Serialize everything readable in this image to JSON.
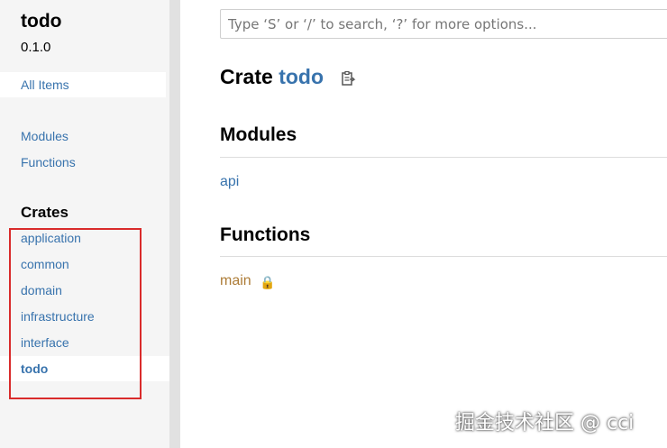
{
  "sidebar": {
    "crate_name": "todo",
    "version": "0.1.0",
    "all_items": "All Items",
    "links": [
      "Modules",
      "Functions"
    ],
    "crates_heading": "Crates",
    "crates": [
      "application",
      "common",
      "domain",
      "infrastructure",
      "interface",
      "todo"
    ],
    "current_crate": "todo"
  },
  "search": {
    "placeholder": "Type ‘S’ or ‘/’ to search, ‘?’ for more options..."
  },
  "main": {
    "title_prefix": "Crate ",
    "title_crate": "todo",
    "copy_icon": "clipboard-icon",
    "modules_heading": "Modules",
    "modules": [
      "api"
    ],
    "functions_heading": "Functions",
    "functions": [
      "main"
    ],
    "function_badge_icon": "lock-icon"
  },
  "watermark": "掘金技术社区 @ cci",
  "colors": {
    "link": "#3873ad",
    "function": "#ad7c37",
    "sidebar_bg": "#f5f5f5",
    "highlight_box": "#d92b2b"
  }
}
